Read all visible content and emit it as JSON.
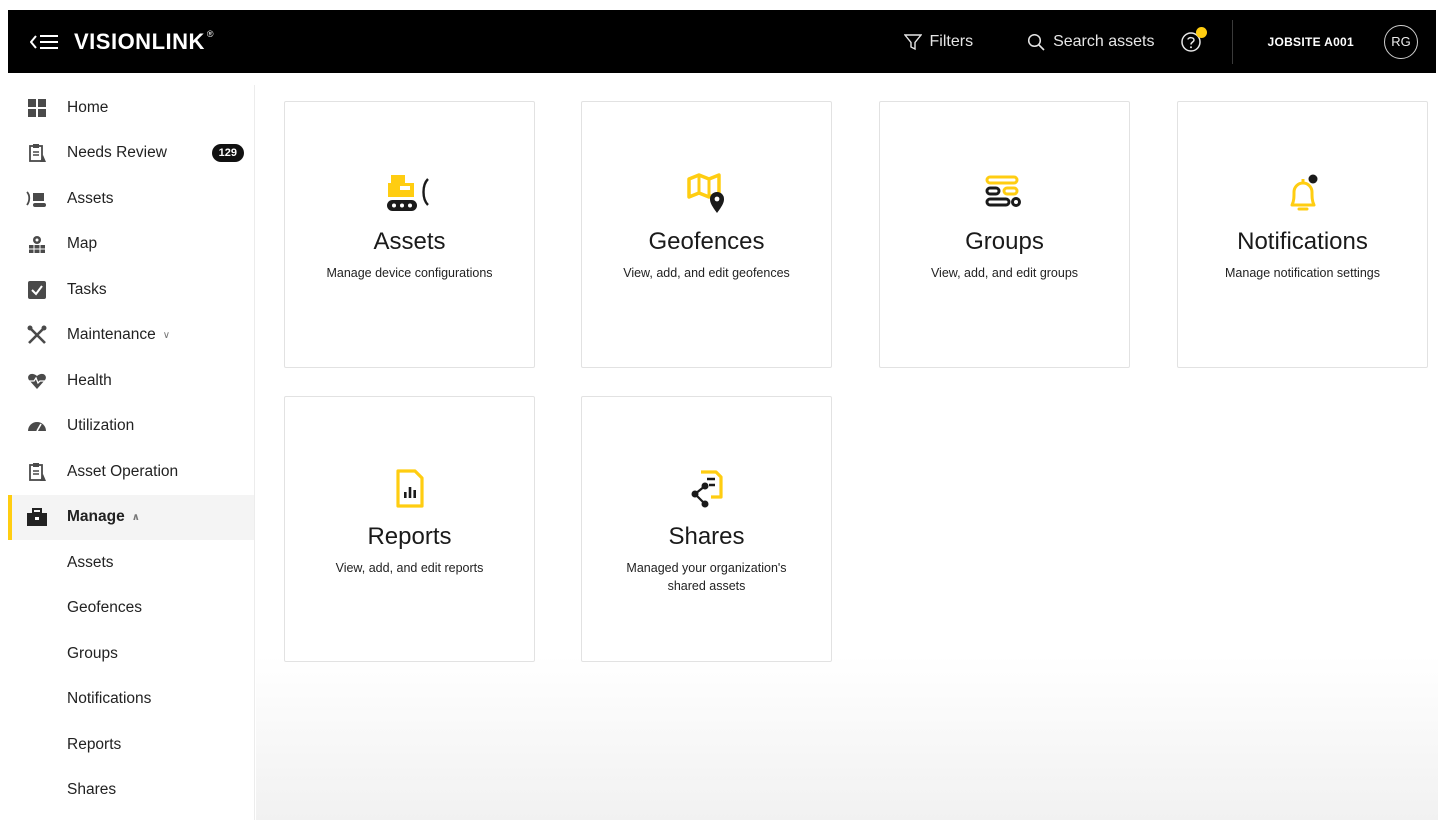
{
  "header": {
    "logo": "VISIONLINK",
    "logo_mark": "®",
    "filters_label": "Filters",
    "search_label": "Search assets",
    "jobsite": "JOBSITE A001",
    "avatar_initials": "RG"
  },
  "sidebar": {
    "items": [
      {
        "label": "Home",
        "icon": "grid-icon"
      },
      {
        "label": "Needs Review",
        "icon": "clipboard-icon",
        "badge": "129"
      },
      {
        "label": "Assets",
        "icon": "excavator-icon"
      },
      {
        "label": "Map",
        "icon": "map-icon"
      },
      {
        "label": "Tasks",
        "icon": "tasks-icon"
      },
      {
        "label": "Maintenance",
        "icon": "wrench-icon"
      },
      {
        "label": "Health",
        "icon": "heart-icon"
      },
      {
        "label": "Utilization",
        "icon": "gauge-icon"
      },
      {
        "label": "Asset Operation",
        "icon": "clipboard-icon"
      },
      {
        "label": "Manage",
        "icon": "briefcase-icon"
      }
    ],
    "manage_sub": [
      "Assets",
      "Geofences",
      "Groups",
      "Notifications",
      "Reports",
      "Shares"
    ]
  },
  "cards": [
    {
      "title": "Assets",
      "desc": "Manage device configurations",
      "icon": "asset-machine-icon"
    },
    {
      "title": "Geofences",
      "desc": "View, add, and edit geofences",
      "icon": "geofence-map-icon"
    },
    {
      "title": "Groups",
      "desc": "View, add, and edit groups",
      "icon": "groups-list-icon"
    },
    {
      "title": "Notifications",
      "desc": "Manage notification settings",
      "icon": "bell-icon"
    },
    {
      "title": "Reports",
      "desc": "View, add, and edit reports",
      "icon": "report-chart-icon"
    },
    {
      "title": "Shares",
      "desc": "Managed your organization's shared assets",
      "icon": "share-doc-icon"
    }
  ],
  "colors": {
    "accent": "#ffcd11",
    "topbar": "#000000"
  }
}
